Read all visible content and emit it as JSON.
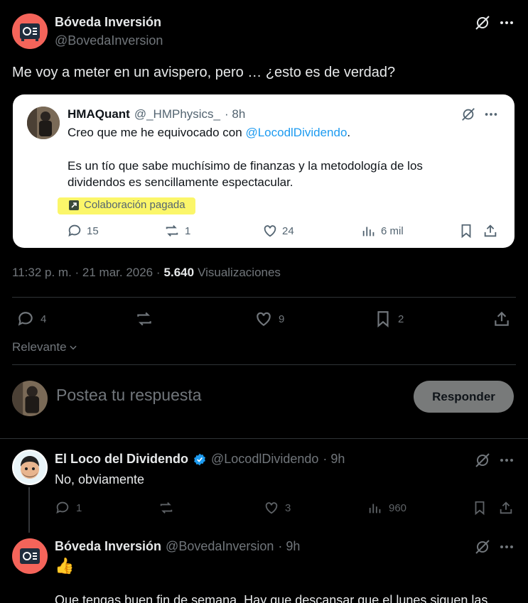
{
  "main_post": {
    "author_name": "Bóveda Inversión",
    "author_handle": "@BovedaInversion",
    "text": "Me voy a meter en un avispero, pero … ¿esto es de verdad?",
    "timestamp": "11:32 p. m. · 21 mar. 2026 ·",
    "views_count": "5.640",
    "views_label": "Visualizaciones",
    "actions": {
      "replies": "4",
      "reposts": "",
      "likes": "9",
      "bookmarks": "2"
    }
  },
  "quoted_post": {
    "author_name": "HMAQuant",
    "author_handle": "@_HMPhysics_",
    "time": "· 8h",
    "line1_prefix": "Creo que me he equivocado con ",
    "line1_mention": "@LocodlDividendo",
    "line1_suffix": ".",
    "line2": "Es un tío que sabe muchísimo de finanzas y la metodología de los",
    "line3": "dividendos es sencillamente espectacular.",
    "collab_label": "Colaboración pagada",
    "actions": {
      "replies": "15",
      "reposts": "1",
      "likes": "24",
      "views": "6 mil"
    }
  },
  "sort": {
    "label": "Relevante"
  },
  "composer": {
    "placeholder": "Postea tu respuesta",
    "button": "Responder"
  },
  "replies": [
    {
      "author_name": "El Loco del Dividendo",
      "author_handle": "@LocodlDividendo",
      "time": "· 9h",
      "text": "No, obviamente",
      "actions": {
        "replies": "1",
        "reposts": "",
        "likes": "3",
        "views": "960"
      }
    },
    {
      "author_name": "Bóveda Inversión",
      "author_handle": "@BovedaInversion",
      "time": "· 9h",
      "emoji": "👍",
      "text": "Que tengas buen fin de semana. Hay que descansar que el lunes siguen las"
    }
  ],
  "colors": {
    "accent": "#1d9bf0",
    "safe_avatar": "#f4645a",
    "highlight": "#fbf66a"
  }
}
